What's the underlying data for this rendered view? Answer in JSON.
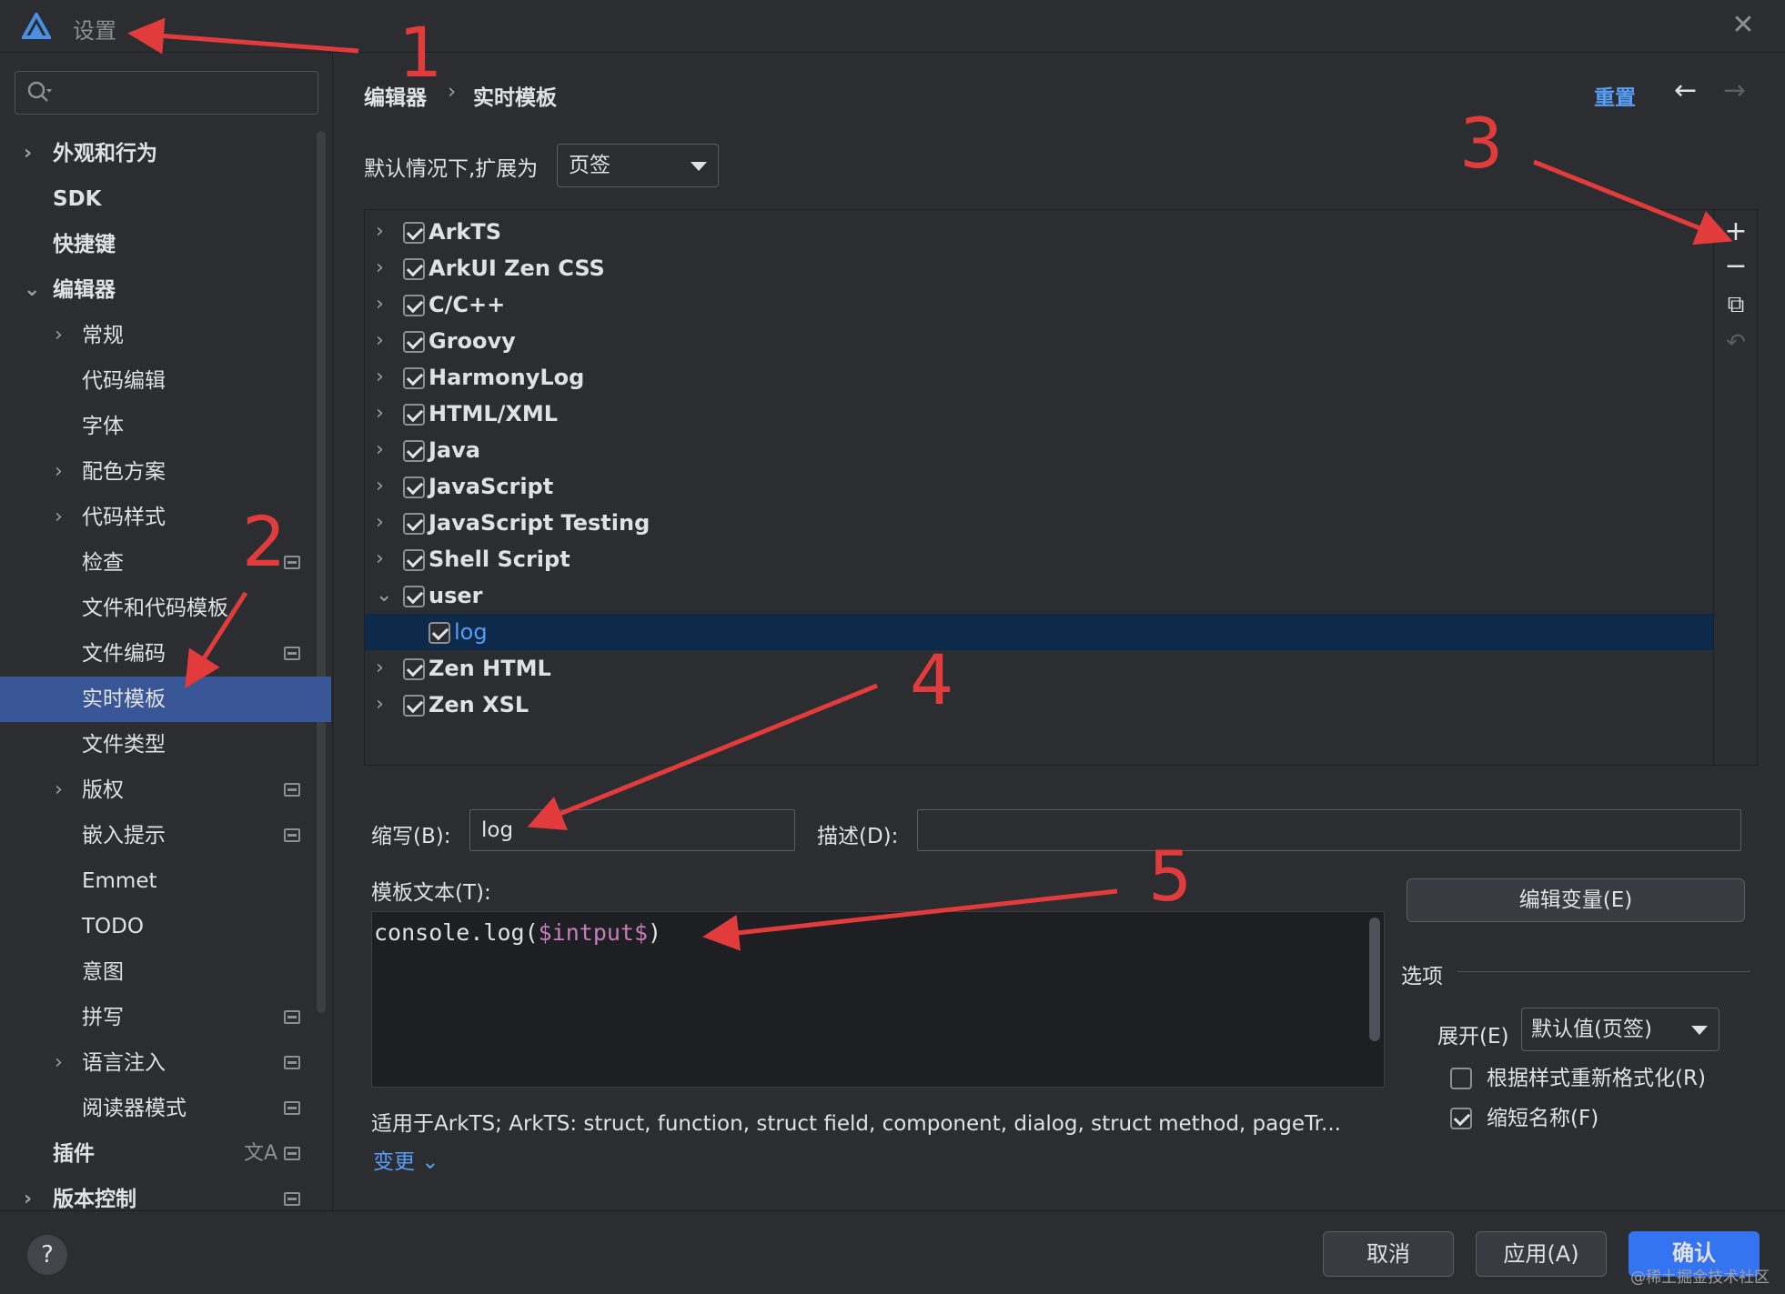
{
  "window": {
    "title": "设置",
    "close_glyph": "✕"
  },
  "sidebar": {
    "search_placeholder": "",
    "items": [
      {
        "label": "外观和行为",
        "chevron": "›"
      },
      {
        "label": "SDK"
      },
      {
        "label": "快捷键"
      },
      {
        "label": "编辑器",
        "chevron": "⌄"
      },
      {
        "label": "常规",
        "chevron": "›"
      },
      {
        "label": "代码编辑"
      },
      {
        "label": "字体"
      },
      {
        "label": "配色方案",
        "chevron": "›"
      },
      {
        "label": "代码样式",
        "chevron": "›"
      },
      {
        "label": "检查"
      },
      {
        "label": "文件和代码模板"
      },
      {
        "label": "文件编码"
      },
      {
        "label": "实时模板"
      },
      {
        "label": "文件类型"
      },
      {
        "label": "版权",
        "chevron": "›"
      },
      {
        "label": "嵌入提示"
      },
      {
        "label": "Emmet"
      },
      {
        "label": "TODO"
      },
      {
        "label": "意图"
      },
      {
        "label": "拼写"
      },
      {
        "label": "语言注入",
        "chevron": "›"
      },
      {
        "label": "阅读器模式"
      },
      {
        "label": "插件"
      },
      {
        "label": "版本控制",
        "chevron": "›"
      }
    ]
  },
  "header": {
    "breadcrumb": [
      "编辑器",
      "实时模板"
    ],
    "breadcrumb_sep": "›",
    "reset": "重置",
    "back_glyph": "←",
    "forward_glyph": "→"
  },
  "expand_default": {
    "label": "默认情况下,扩展为",
    "value": "页签"
  },
  "tree": {
    "groups": [
      {
        "label": "ArkTS",
        "checked": true,
        "chevron": "›"
      },
      {
        "label": "ArkUI Zen CSS",
        "checked": true,
        "chevron": "›"
      },
      {
        "label": "C/C++",
        "checked": true,
        "chevron": "›"
      },
      {
        "label": "Groovy",
        "checked": true,
        "chevron": "›"
      },
      {
        "label": "HarmonyLog",
        "checked": true,
        "chevron": "›"
      },
      {
        "label": "HTML/XML",
        "checked": true,
        "chevron": "›"
      },
      {
        "label": "Java",
        "checked": true,
        "chevron": "›"
      },
      {
        "label": "JavaScript",
        "checked": true,
        "chevron": "›"
      },
      {
        "label": "JavaScript Testing",
        "checked": true,
        "chevron": "›"
      },
      {
        "label": "Shell Script",
        "checked": true,
        "chevron": "›"
      },
      {
        "label": "user",
        "checked": true,
        "chevron": "⌄"
      },
      {
        "label": "log",
        "checked": true
      },
      {
        "label": "Zen HTML",
        "checked": true,
        "chevron": "›"
      },
      {
        "label": "Zen XSL",
        "checked": true,
        "chevron": "›"
      }
    ],
    "toolbar": {
      "add_glyph": "+",
      "remove_glyph": "−",
      "copy_glyph": "⧉",
      "revert_glyph": "↶"
    }
  },
  "editor": {
    "abbr_label": "缩写(B):",
    "abbr_value": "log",
    "desc_label": "描述(D):",
    "desc_value": "",
    "template_label": "模板文本(T):",
    "template_code_prefix": "console.log(",
    "template_code_var": "$intput$",
    "template_code_suffix": ")",
    "applies_to": "适用于ArkTS; ArkTS: struct, function, struct field, component, dialog, struct method, pageTr...",
    "change_link": "变更 ⌄",
    "edit_vars": "编辑变量(E)",
    "options_label": "选项",
    "expand_label": "展开(E)",
    "expand_value": "默认值(页签)",
    "reformat_label": "根据样式重新格式化(R)",
    "reformat_checked": false,
    "shorten_label": "缩短名称(F)",
    "shorten_checked": true
  },
  "footer": {
    "help": "?",
    "cancel": "取消",
    "apply": "应用(A)",
    "ok": "确认",
    "watermark": "@稀土掘金技术社区"
  },
  "annotations": {
    "numbers": [
      "1",
      "2",
      "3",
      "4",
      "5"
    ],
    "color": "#e23b3b"
  },
  "colors": {
    "background": "#2b2d30",
    "selection": "#3b5a9b",
    "tree_selection": "#0d2a4a",
    "link": "#589df6",
    "primary_button": "#3574f0"
  },
  "translate_icon_glyph": "文A"
}
